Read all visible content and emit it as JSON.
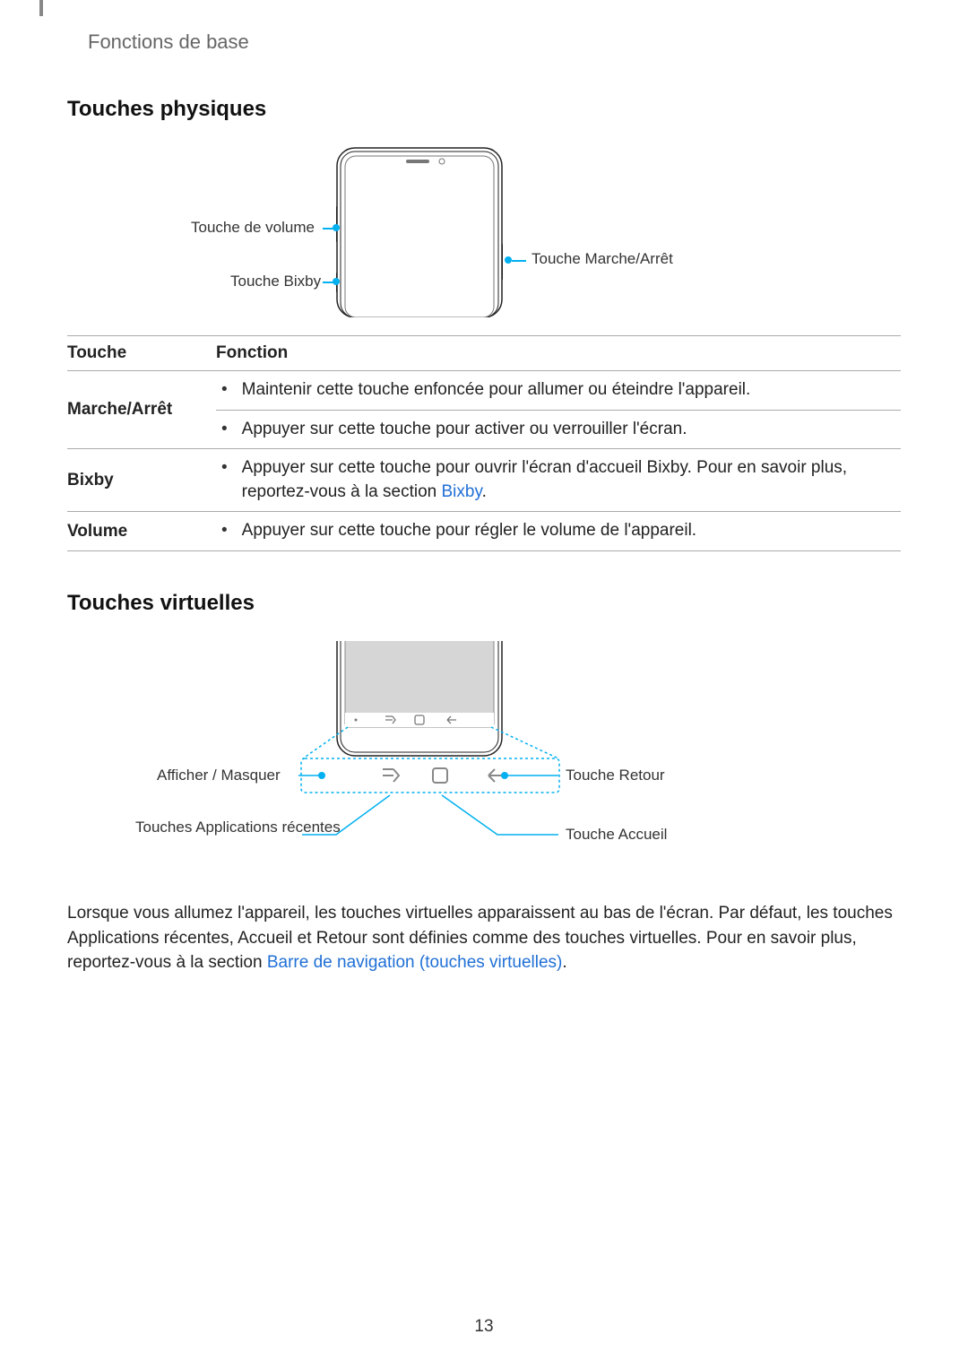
{
  "breadcrumb": "Fonctions de base",
  "section1": {
    "heading": "Touches physiques",
    "labels": {
      "volume": "Touche de volume",
      "bixby": "Touche Bixby",
      "power": "Touche Marche/Arrêt"
    }
  },
  "keys_table": {
    "header": {
      "col1": "Touche",
      "col2": "Fonction"
    },
    "rows": [
      {
        "name": "Marche/Arrêt",
        "items": [
          "Maintenir cette touche enfoncée pour allumer ou éteindre l'appareil.",
          "Appuyer sur cette touche pour activer ou verrouiller l'écran."
        ]
      },
      {
        "name": "Bixby",
        "items_html": [
          {
            "pre": "Appuyer sur cette touche pour ouvrir l'écran d'accueil Bixby. Pour en savoir plus, reportez-vous à la section ",
            "link": "Bixby",
            "post": "."
          }
        ]
      },
      {
        "name": "Volume",
        "items": [
          "Appuyer sur cette touche pour régler le volume de l'appareil."
        ]
      }
    ]
  },
  "section2": {
    "heading": "Touches virtuelles",
    "labels": {
      "show_hide": "Afficher / Masquer",
      "recents": "Touches Applications récentes",
      "back": "Touche Retour",
      "home": "Touche Accueil"
    },
    "paragraph": {
      "pre": "Lorsque vous allumez l'appareil, les touches virtuelles apparaissent au bas de l'écran. Par défaut, les touches Applications récentes, Accueil et Retour sont définies comme des touches virtuelles. Pour en savoir plus, reportez-vous à la section ",
      "link": "Barre de navigation (touches virtuelles)",
      "post": "."
    }
  },
  "page_number": "13"
}
